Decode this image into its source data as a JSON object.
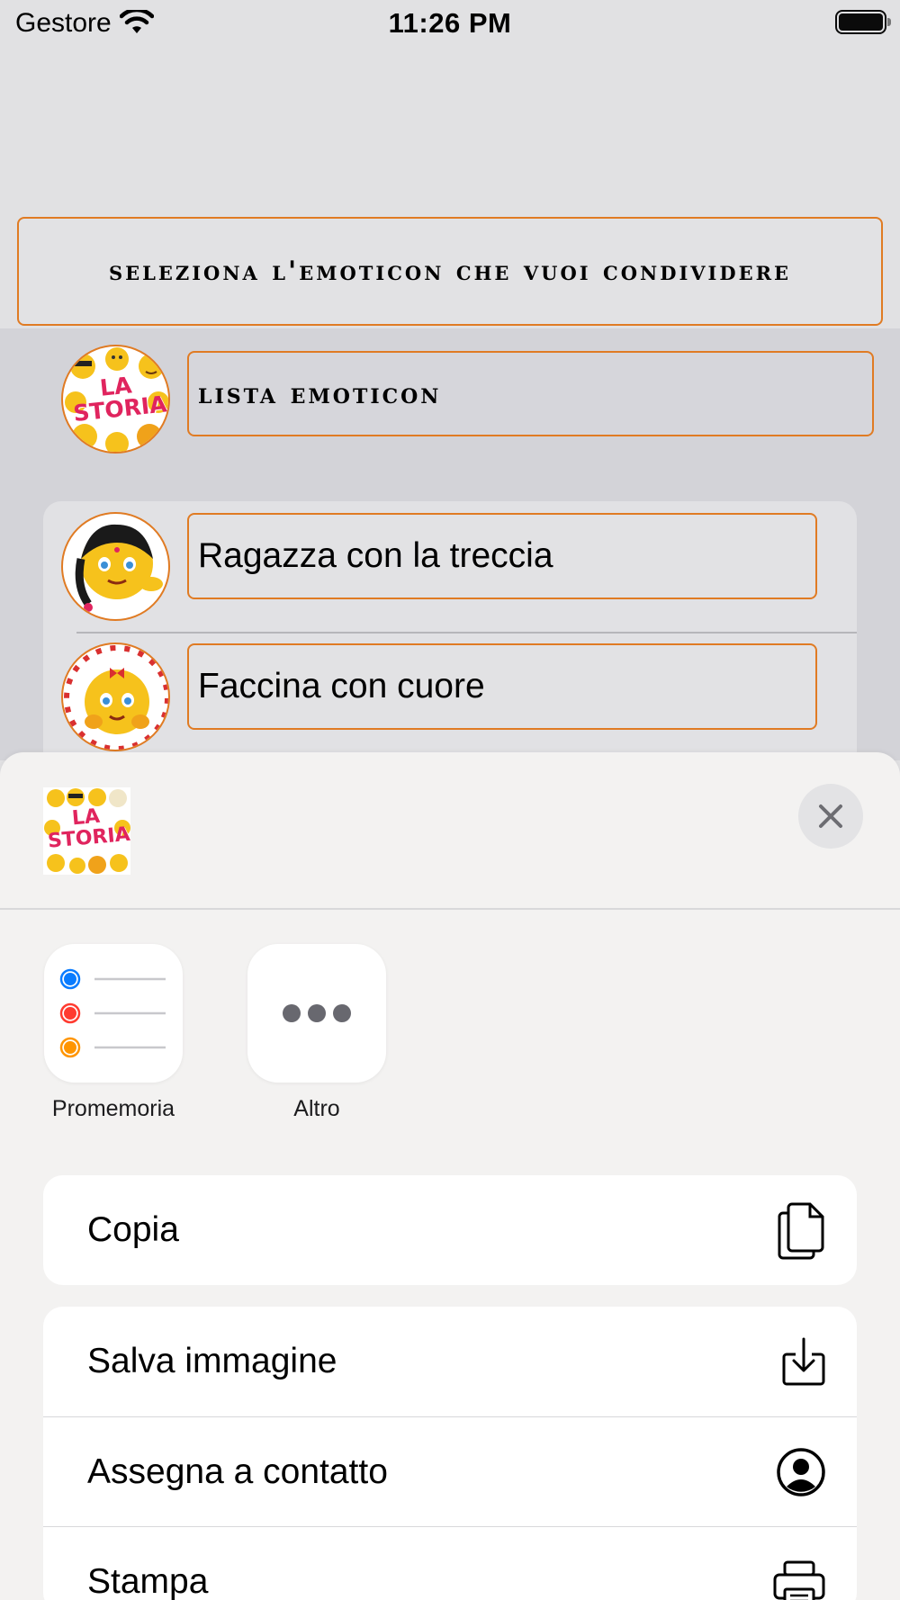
{
  "status_bar": {
    "carrier": "Gestore",
    "time": "11:26 PM"
  },
  "header": {
    "title": "seleziona l'emoticon che vuoi condividere"
  },
  "list": {
    "section_label": "lista emoticon",
    "items": [
      {
        "label": "Ragazza con la treccia"
      },
      {
        "label": "Faccina con cuore"
      }
    ]
  },
  "logo_text": "LA STORIA!",
  "share_sheet": {
    "apps": [
      {
        "label": "Promemoria",
        "icon": "reminders-icon"
      },
      {
        "label": "Altro",
        "icon": "more-icon"
      }
    ],
    "actions": [
      {
        "label": "Copia",
        "icon": "copy-icon"
      },
      {
        "label": "Salva immagine",
        "icon": "save-image-icon"
      },
      {
        "label": "Assegna a contatto",
        "icon": "contact-icon"
      },
      {
        "label": "Stampa",
        "icon": "print-icon"
      }
    ]
  },
  "colors": {
    "accent_border": "#e07b23",
    "background": "#e1e1e3",
    "sheet_background": "#f3f2f1"
  }
}
